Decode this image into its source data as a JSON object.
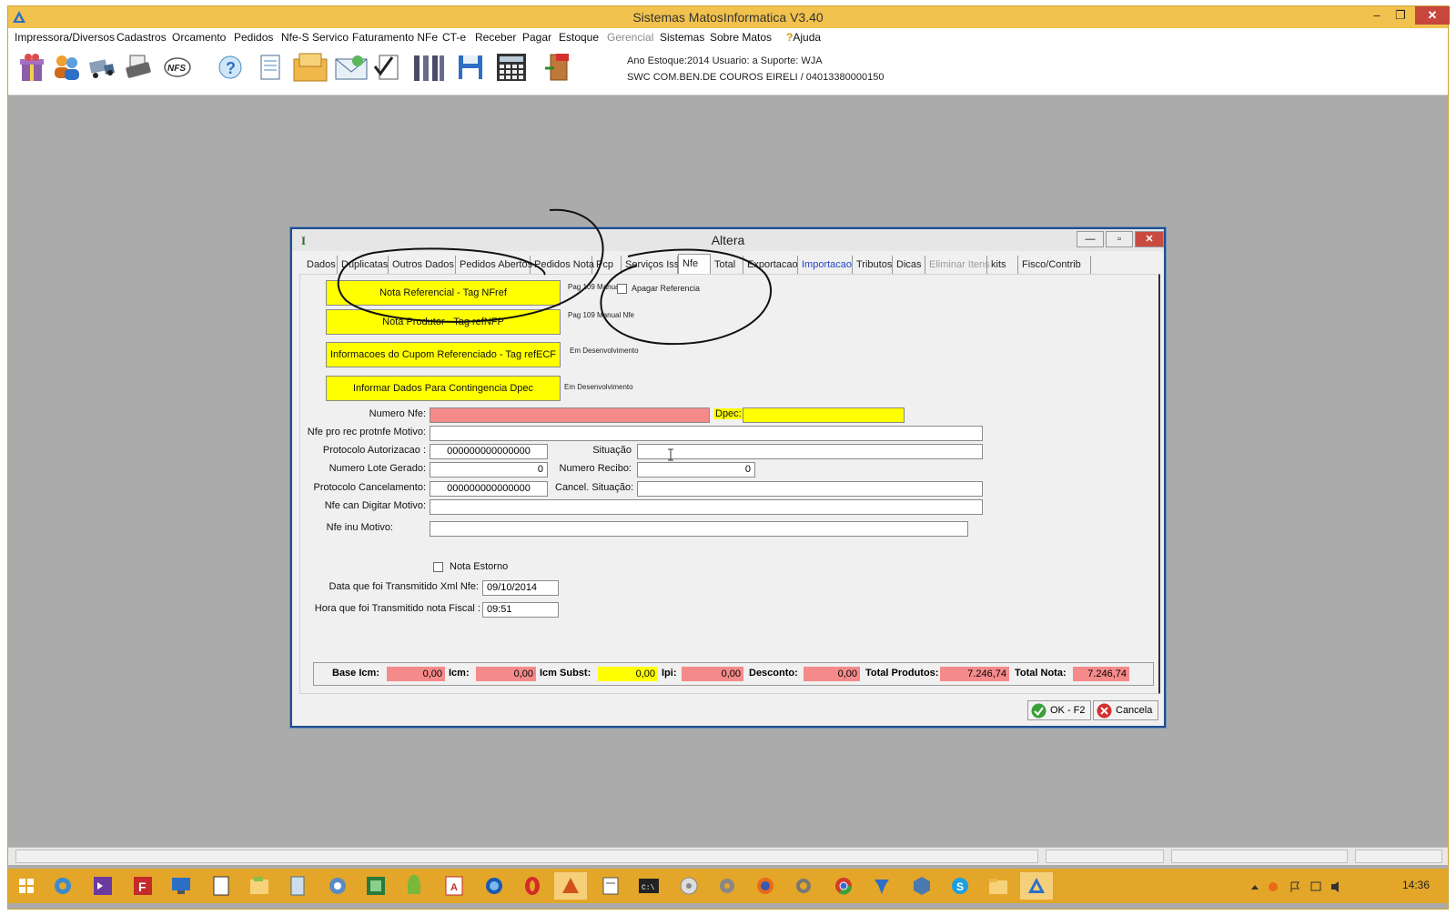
{
  "window": {
    "title": "Sistemas MatosInformatica V3.40",
    "controls": {
      "minimize": "–",
      "restore": "❐",
      "close": "✕"
    }
  },
  "menu": {
    "items": [
      "Impressora/Diversos",
      "Cadastros",
      "Orcamento",
      "Pedidos",
      "Nfe-S Servico",
      "Faturamento NFe",
      "CT-e",
      "Receber",
      "Pagar",
      "Estoque",
      "Gerencial",
      "Sistemas",
      "Sobre Matos",
      "Ajuda"
    ],
    "disabled": [
      "Gerencial"
    ]
  },
  "toolbar": {
    "icons": [
      "gift-icon",
      "users-icon",
      "truck-icon",
      "printer-icon",
      "nfs-icon",
      "help-icon",
      "documents-icon",
      "package-icon",
      "mail-icon",
      "checklist-icon",
      "tools-icon",
      "save-icon",
      "calculator-icon",
      "exit-icon"
    ],
    "nfs_text": "NFS",
    "info_line1": "Ano Estoque:2014 Usuario: a Suporte: WJA",
    "info_line2": "SWC COM.BEN.DE COUROS EIRELI / 04013380000150"
  },
  "dialog": {
    "title": "Altera",
    "tabs": [
      {
        "label": "Dados"
      },
      {
        "label": "Duplicatas"
      },
      {
        "label": "Outros Dados"
      },
      {
        "label": "Pedidos Abertos"
      },
      {
        "label": "Pedidos Nota"
      },
      {
        "label": "Pcp"
      },
      {
        "label": "Serviços Iss"
      },
      {
        "label": "Nfe",
        "active": true
      },
      {
        "label": "Total"
      },
      {
        "label": "Exportacao"
      },
      {
        "label": "Importacao",
        "link": true
      },
      {
        "label": "Tributos"
      },
      {
        "label": "Dicas"
      },
      {
        "label": "Eliminar Itens",
        "disabled": true
      },
      {
        "label": "kits"
      },
      {
        "label": "Fisco/Contrib"
      }
    ],
    "buttons": {
      "nota_referencial": "Nota Referencial - Tag NFref",
      "nota_produtor": "Nota Produtor - Tag refNFP",
      "cupom_referenciado": "Informacoes do Cupom Referenciado - Tag refECF",
      "contingencia_dpec": "Informar Dados Para Contingencia Dpec"
    },
    "notes": {
      "pag_manual": "Pag 109 Manual",
      "apagar_referencia": "Apagar Referencia",
      "pag_manual_nfe": "Pag 109 Manual Nfe",
      "em_desenvolvimento_1": "Em Desenvolvimento",
      "em_desenvolvimento_2": "Em Desenvolvimento"
    },
    "fields": {
      "numero_nfe": {
        "label": "Numero Nfe:",
        "value": ""
      },
      "dpec": {
        "label": "Dpec:",
        "value": ""
      },
      "nfe_pro_rec_motivo": {
        "label": "Nfe pro rec protnfe Motivo:",
        "value": ""
      },
      "protocolo_autorizacao": {
        "label": "Protocolo Autorizacao :",
        "value": "000000000000000"
      },
      "situacao": {
        "label": "Situação",
        "value": ""
      },
      "numero_lote_gerado": {
        "label": "Numero Lote Gerado:",
        "value": "0"
      },
      "numero_recibo": {
        "label": "Numero Recibo:",
        "value": "0"
      },
      "protocolo_cancelamento": {
        "label": "Protocolo Cancelamento:",
        "value": "000000000000000"
      },
      "cancel_situacao": {
        "label": "Cancel. Situação:",
        "value": ""
      },
      "nfe_can_digitar_motivo": {
        "label": "Nfe can Digitar Motivo:",
        "value": ""
      },
      "nfe_inu_motivo": {
        "label": "Nfe inu Motivo:",
        "value": ""
      },
      "nota_estorno": {
        "label": "Nota Estorno",
        "checked": false
      },
      "data_transmitido": {
        "label": "Data que foi Transmitido Xml Nfe:",
        "value": "09/10/2014"
      },
      "hora_transmitido": {
        "label": "Hora que foi Transmitido nota Fiscal :",
        "value": "09:51"
      }
    },
    "totals": {
      "base_icm": {
        "label": "Base Icm:",
        "value": "0,00"
      },
      "icm": {
        "label": "Icm:",
        "value": "0,00"
      },
      "icm_subst": {
        "label": "Icm Subst:",
        "value": "0,00"
      },
      "ipi": {
        "label": "Ipi:",
        "value": "0,00"
      },
      "desconto": {
        "label": "Desconto:",
        "value": "0,00"
      },
      "total_produtos": {
        "label": "Total Produtos:",
        "value": "7.246,74"
      },
      "total_nota": {
        "label": "Total Nota:",
        "value": "7.246,74"
      }
    },
    "ok_label": "OK - F2",
    "cancel_label": "Cancela"
  },
  "taskbar": {
    "clock": "14:36"
  },
  "colors": {
    "title_bar": "#f2c24e",
    "taskbar": "#e3a629",
    "field_red": "#f58a8a",
    "field_yellow": "#ffff00",
    "link_blue": "#2545c8"
  }
}
